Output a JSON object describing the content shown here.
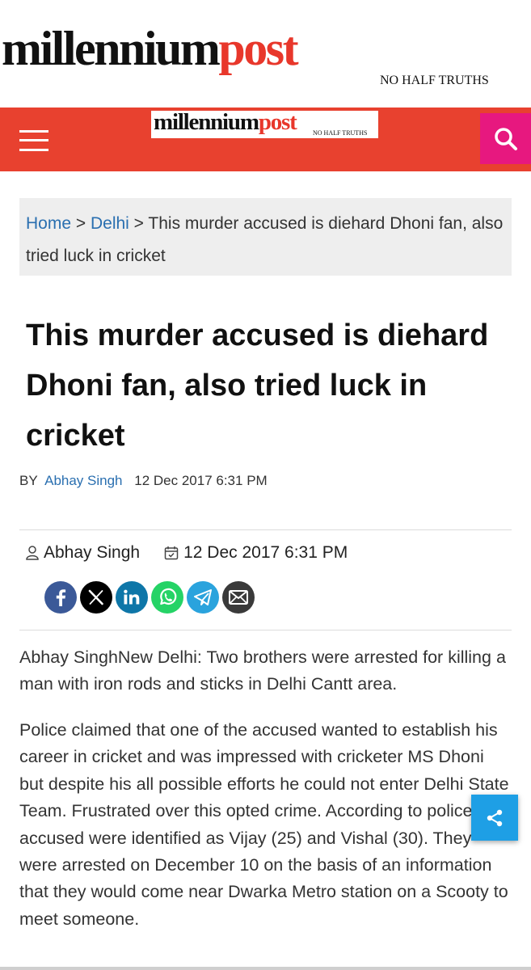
{
  "brand": {
    "name_main": "millennium",
    "name_accent": "post",
    "tagline": "NO HALF TRUTHS",
    "accent_color": "#e8372b",
    "header_bar_color": "#e8412f",
    "search_button_color": "#e7187f"
  },
  "header": {
    "menu_icon": "hamburger-menu-icon",
    "search_icon": "search-icon"
  },
  "breadcrumb": {
    "home": "Home",
    "sep1": " > ",
    "section": "Delhi",
    "sep2": " > ",
    "current": "This murder accused is diehard Dhoni fan, also tried luck in cricket"
  },
  "article": {
    "title": "This murder accused is diehard Dhoni fan, also tried luck in cricket",
    "by_label": "BY",
    "author": "Abhay Singh",
    "date": "12 Dec 2017 6:31 PM",
    "meta_author": "Abhay Singh",
    "meta_date": "12 Dec 2017 6:31 PM",
    "paragraphs": [
      "Abhay SinghNew Delhi: Two brothers were arrested for killing a man with iron rods and sticks in Delhi Cantt area.",
      "Police claimed that one of the accused wanted to establish his career in cricket and was impressed with cricketer MS Dhoni but despite his all possible efforts he could not enter Delhi State Team. Frustrated over this opted crime. According to police, the accused were identified as Vijay (25) and Vishal (30). They were arrested on December 10 on the basis of an information that they would come near Dwarka Metro station on a Scooty to meet someone."
    ]
  },
  "share": [
    {
      "name": "facebook",
      "icon": "facebook-icon",
      "color": "#3b5998"
    },
    {
      "name": "x",
      "icon": "x-icon",
      "color": "#000000"
    },
    {
      "name": "linkedin",
      "icon": "linkedin-icon",
      "color": "#0e76a8"
    },
    {
      "name": "whatsapp",
      "icon": "whatsapp-icon",
      "color": "#25d366"
    },
    {
      "name": "telegram",
      "icon": "telegram-icon",
      "color": "#2aa3dd"
    },
    {
      "name": "email",
      "icon": "email-icon",
      "color": "#3a3a3a"
    }
  ],
  "floating_share": {
    "icon": "share-icon",
    "color": "#1e9fe5"
  }
}
